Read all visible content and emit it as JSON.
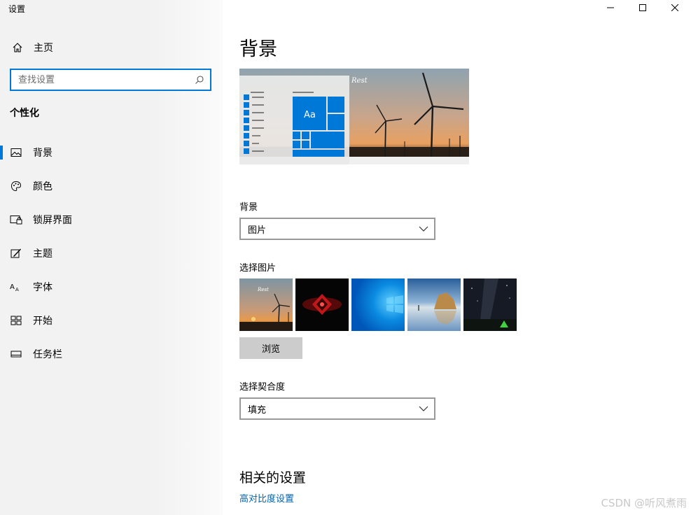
{
  "window": {
    "title": "设置",
    "controls": [
      "minimize",
      "maximize",
      "close"
    ]
  },
  "sidebar": {
    "home_label": "主页",
    "search_placeholder": "查找设置",
    "section_title": "个性化",
    "items": [
      {
        "label": "背景",
        "icon": "picture-icon",
        "active": true
      },
      {
        "label": "颜色",
        "icon": "palette-icon",
        "active": false
      },
      {
        "label": "锁屏界面",
        "icon": "lock-screen-icon",
        "active": false
      },
      {
        "label": "主题",
        "icon": "theme-brush-icon",
        "active": false
      },
      {
        "label": "字体",
        "icon": "font-icon",
        "active": false
      },
      {
        "label": "开始",
        "icon": "start-icon",
        "active": false
      },
      {
        "label": "任务栏",
        "icon": "taskbar-icon",
        "active": false
      }
    ]
  },
  "main": {
    "title": "背景",
    "preview": {
      "sample_text": "Aa"
    },
    "background_label": "背景",
    "background_value": "图片",
    "choose_picture_label": "选择图片",
    "thumbnails": [
      "wind-turbines-sunset",
      "red-abstract-logo",
      "windows-blue",
      "sea-rock-arch",
      "night-sky-tent"
    ],
    "browse_label": "浏览",
    "fit_label": "选择契合度",
    "fit_value": "填充",
    "related_title": "相关的设置",
    "related_link": "高对比度设置"
  },
  "watermark": "CSDN @听风煮雨",
  "colors": {
    "accent": "#0078d7",
    "link": "#0063b1",
    "sidebar_bg": "#f2f2f2",
    "button_bg": "#cccccc"
  }
}
